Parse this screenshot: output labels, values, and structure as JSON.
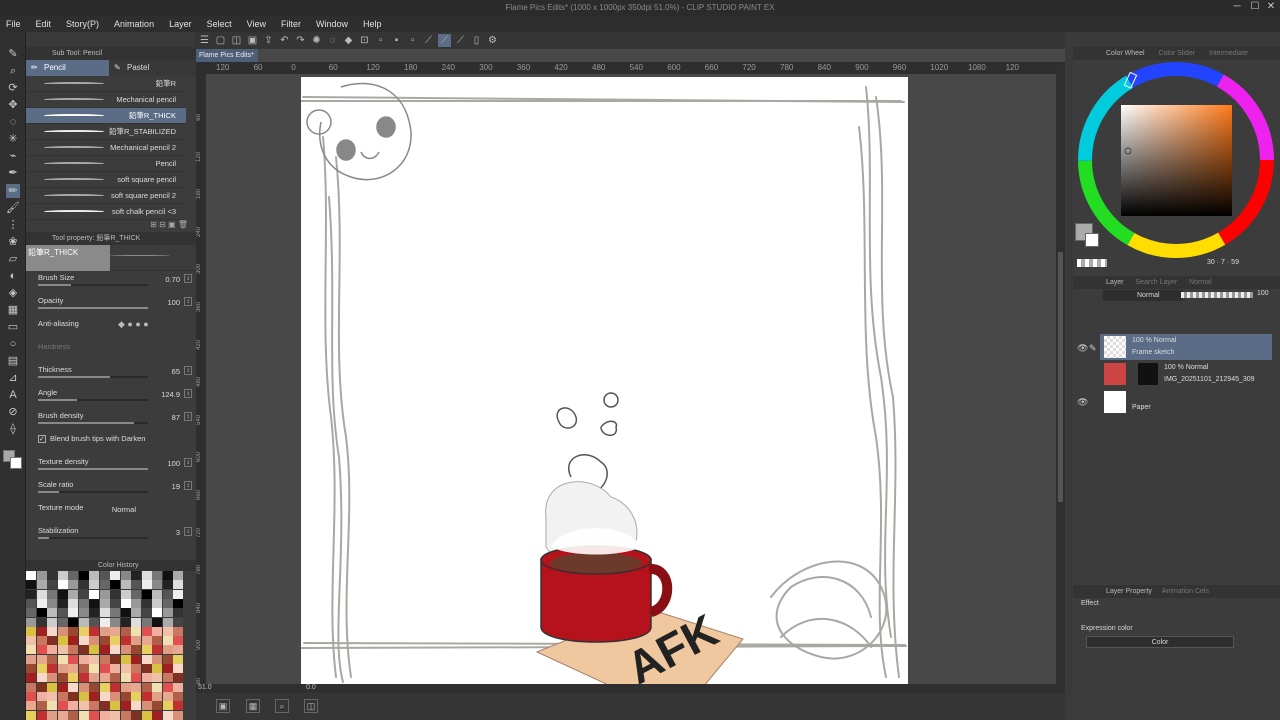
{
  "window": {
    "title": "Flame Pics Edits* (1000 x 1000px 350dpi 51.0%)  - CLIP STUDIO PAINT EX",
    "minimize": "─",
    "maximize": "☐",
    "close": "✕"
  },
  "menu": [
    "File",
    "Edit",
    "Story(P)",
    "Animation",
    "Layer",
    "Select",
    "View",
    "Filter",
    "Window",
    "Help"
  ],
  "doc_tab": {
    "label": "Flame Pics Edits*",
    "close": "×"
  },
  "ruler_top": [
    "120",
    "60",
    "0",
    "60",
    "120",
    "180",
    "240",
    "300",
    "360",
    "420",
    "480",
    "540",
    "600",
    "660",
    "720",
    "780",
    "840",
    "900",
    "960",
    "1020",
    "1080",
    "120"
  ],
  "ruler_left": [
    "60",
    "120",
    "180",
    "240",
    "300",
    "360",
    "420",
    "480",
    "540",
    "600",
    "660",
    "720",
    "780",
    "840",
    "900",
    "960"
  ],
  "sub_tool": {
    "header": "Sub Tool: Pencil",
    "tabs": [
      "Pencil",
      "Pastel"
    ],
    "brushes": [
      "鉛筆R",
      "Mechanical pencil",
      "鉛筆R_THICK",
      "鉛筆R_STABILIZED",
      "Mechanical pencil 2",
      "Pencil",
      "soft square pencil",
      "soft square pencil 2",
      "soft chalk pencil <3"
    ]
  },
  "tool_property": {
    "header": "Tool property: 鉛筆R_THICK",
    "brush_name": "鉛筆R_THICK",
    "props": [
      {
        "label": "Brush Size",
        "value": "0.70",
        "level": 0.3
      },
      {
        "label": "Opacity",
        "value": "100",
        "level": 1.0
      },
      {
        "label": "Anti-aliasing",
        "value": ""
      },
      {
        "label": "Hardness",
        "value": ""
      },
      {
        "label": "Thickness",
        "value": "65",
        "level": 0.65
      },
      {
        "label": "Angle",
        "value": "124.9",
        "level": 0.35
      },
      {
        "label": "Brush density",
        "value": "87",
        "level": 0.87
      },
      {
        "label": "Blend brush tips with Darken",
        "value": ""
      },
      {
        "label": "Texture density",
        "value": "100",
        "level": 1.0
      },
      {
        "label": "Scale ratio",
        "value": "19",
        "level": 0.19
      },
      {
        "label": "Texture mode",
        "value": "Normal"
      },
      {
        "label": "Stabilization",
        "value": "3",
        "level": 0.1
      }
    ]
  },
  "color_history": {
    "header": "Color History"
  },
  "zoom": {
    "value": "51.0",
    "angle": "0.0"
  },
  "color_wheel": {
    "header": "Color Wheel",
    "tabs": [
      "Color Slider",
      "Intermediate"
    ],
    "values": [
      "30",
      "7",
      "59"
    ]
  },
  "layers": {
    "header": "Layer",
    "tabs": [
      "Search Layer",
      "Normal"
    ],
    "blend_mode": "Normal",
    "opacity": "100",
    "items": [
      {
        "blend": "100 % Normal",
        "name": "Frame sketch"
      },
      {
        "blend": "100 % Normal",
        "name": "IMG_20251101_212945_309"
      },
      {
        "blend": "",
        "name": "Paper"
      }
    ]
  },
  "layer_property": {
    "header": "Layer Property",
    "tab": "Animation Cels",
    "effect_label": "Effect",
    "expression_label": "Expression color",
    "expression_value": "Color"
  },
  "artwork": {
    "note_text": "AFK"
  },
  "colors": {
    "accent": "#5a6c86",
    "mug_red": "#b5121b",
    "coffee": "#6b3a2a",
    "note": "#f0c8a0"
  }
}
